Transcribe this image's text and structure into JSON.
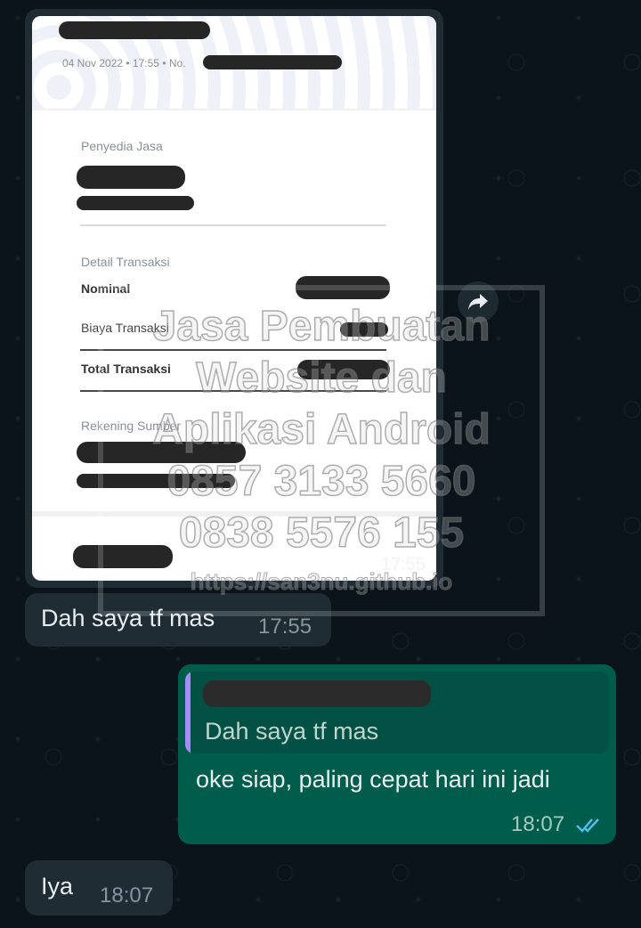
{
  "image_message": {
    "receipt": {
      "date_line": "04 Nov 2022 • 17:55 • No.",
      "provider_label": "Penyedia Jasa",
      "detail_label": "Detail Transaksi",
      "nominal_label": "Nominal",
      "fee_label": "Biaya Transaksi",
      "total_label": "Total Transaksi",
      "source_label": "Rekening Sumber"
    },
    "time": "17:55",
    "watermark": {
      "lines": [
        "Jasa Pembuatan",
        "Website dan",
        "Aplikasi Android",
        "0857 3133 5660",
        "0838 5576 155"
      ],
      "url": "https://san3nu.github.io"
    }
  },
  "messages": [
    {
      "text": "Dah saya tf mas",
      "time": "17:55"
    },
    {
      "quoted_text": "Dah saya tf mas",
      "text": "oke siap, paling cepat hari ini jadi",
      "time": "18:07",
      "status": "double-check-read"
    },
    {
      "text": "Iya",
      "time": "18:07"
    }
  ],
  "colors": {
    "background": "#0b141a",
    "incoming_bubble": "#1f2c34",
    "outgoing_bubble": "#005c4b",
    "read_tick": "#53bdeb",
    "quote_accent": "#a78bfa"
  }
}
